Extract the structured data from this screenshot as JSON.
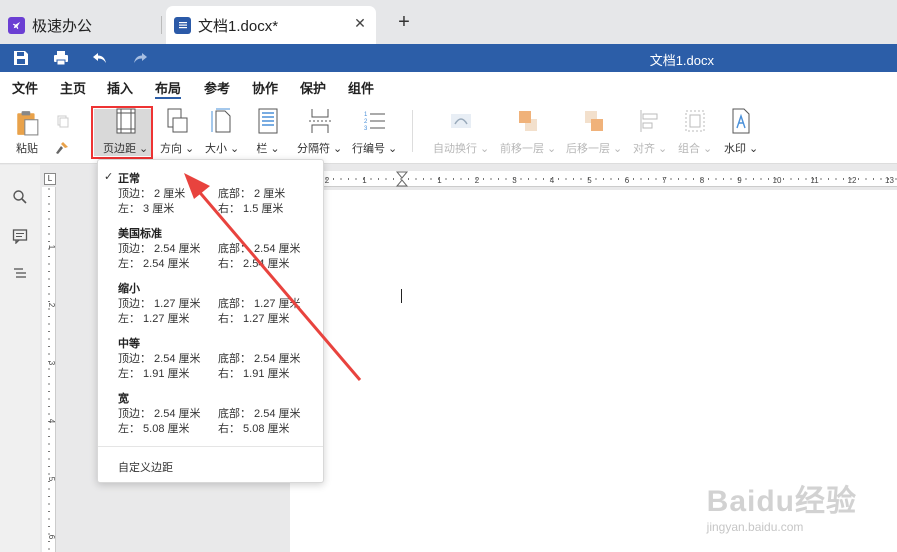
{
  "tabs": {
    "app_label": "极速办公",
    "doc_label": "文档1.docx*",
    "close": "✕",
    "new": "+"
  },
  "title": "文档1.docx",
  "menu": [
    "文件",
    "主页",
    "插入",
    "布局",
    "参考",
    "协作",
    "保护",
    "组件"
  ],
  "ribbon": {
    "paste": "粘贴",
    "margins": "页边距",
    "orientation": "方向",
    "size": "大小",
    "columns": "栏",
    "breaks": "分隔符",
    "line_numbers": "行编号",
    "wrap": "自动换行",
    "bring_forward": "前移一层",
    "send_backward": "后移一层",
    "align": "对齐",
    "group": "组合",
    "watermark": "水印"
  },
  "margins_menu": {
    "options": [
      {
        "name": "正常",
        "checked": true,
        "top": "顶边： 2 厘米",
        "bottom": "底部： 2 厘米",
        "left": "左： 3 厘米",
        "right": "右： 1.5 厘米"
      },
      {
        "name": "美国标准",
        "checked": false,
        "top": "顶边： 2.54 厘米",
        "bottom": "底部： 2.54 厘米",
        "left": "左： 2.54 厘米",
        "right": "右： 2.54 厘米"
      },
      {
        "name": "缩小",
        "checked": false,
        "top": "顶边： 1.27 厘米",
        "bottom": "底部： 1.27 厘米",
        "left": "左： 1.27 厘米",
        "right": "右： 1.27 厘米"
      },
      {
        "name": "中等",
        "checked": false,
        "top": "顶边： 2.54 厘米",
        "bottom": "底部： 2.54 厘米",
        "left": "左： 1.91 厘米",
        "right": "右： 1.91 厘米"
      },
      {
        "name": "宽",
        "checked": false,
        "top": "顶边： 2.54 厘米",
        "bottom": "底部： 2.54 厘米",
        "left": "左： 5.08 厘米",
        "right": "右： 5.08 厘米"
      }
    ],
    "check": "✓",
    "custom": "自定义边距"
  },
  "rulers": {
    "corner": "L",
    "h_labels": [
      "2",
      "1",
      "1",
      "2",
      "3",
      "4",
      "5",
      "6",
      "7",
      "8",
      "9",
      "10",
      "11",
      "12",
      "13"
    ],
    "v_labels": [
      "1",
      "2",
      "3",
      "4",
      "5",
      "6"
    ]
  },
  "watermark": {
    "brand": "Baidu经验",
    "url": "jingyan.baidu.com"
  },
  "colors": {
    "brand_blue": "#2c5ea8",
    "highlight_red": "#e33333",
    "app_purple": "#6b3fd3"
  }
}
